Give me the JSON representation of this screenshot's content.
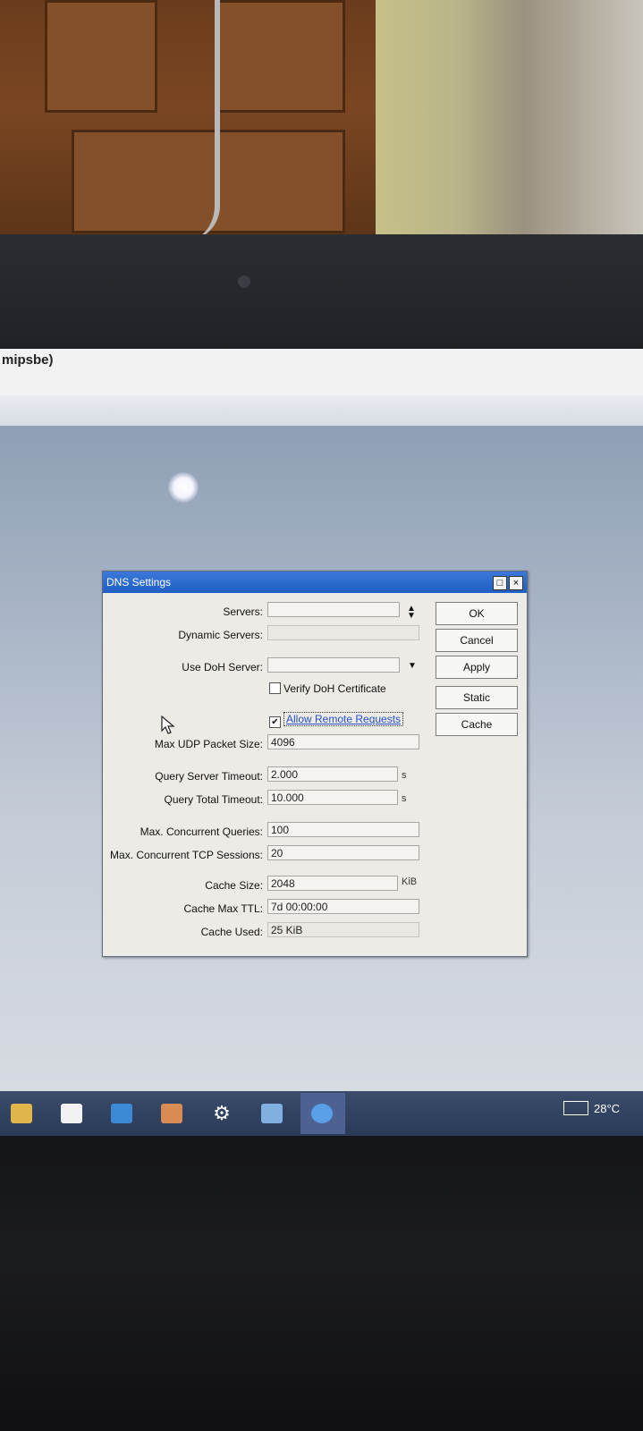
{
  "window": {
    "title_fragment": "mipsbe)"
  },
  "dialog": {
    "title": "DNS Settings",
    "title_buttons": [
      "□",
      "×"
    ],
    "fields": {
      "servers": {
        "label": "Servers:",
        "value": ""
      },
      "dynamic_servers": {
        "label": "Dynamic Servers:",
        "value": ""
      },
      "use_doh_server": {
        "label": "Use DoH Server:",
        "value": ""
      },
      "max_udp_packet_size": {
        "label": "Max UDP Packet Size:",
        "value": "4096"
      },
      "query_server_timeout": {
        "label": "Query Server Timeout:",
        "value": "2.000",
        "unit": "s"
      },
      "query_total_timeout": {
        "label": "Query Total Timeout:",
        "value": "10.000",
        "unit": "s"
      },
      "max_concurrent_queries": {
        "label": "Max. Concurrent Queries:",
        "value": "100"
      },
      "max_concurrent_tcp_sessions": {
        "label": "Max. Concurrent TCP Sessions:",
        "value": "20"
      },
      "cache_size": {
        "label": "Cache Size:",
        "value": "2048",
        "unit": "KiB"
      },
      "cache_max_ttl": {
        "label": "Cache Max TTL:",
        "value": "7d 00:00:00"
      },
      "cache_used": {
        "label": "Cache Used:",
        "value": "25 KiB"
      }
    },
    "checkboxes": {
      "verify_doh_certificate": {
        "label": "Verify DoH Certificate",
        "checked": false
      },
      "allow_remote_requests": {
        "label": "Allow Remote Requests",
        "checked": true
      }
    },
    "buttons": {
      "ok": "OK",
      "cancel": "Cancel",
      "apply": "Apply",
      "static": "Static",
      "cache": "Cache"
    }
  },
  "taskbar": {
    "icons": [
      "file-explorer-icon",
      "store-icon",
      "mail-icon",
      "media-icon",
      "settings-icon",
      "winbox-icon",
      "browser-icon"
    ],
    "temperature": "28°C"
  },
  "colors": {
    "titlebar": "#2a68cc",
    "dialog_bg": "#ecebe6",
    "taskbar": "#2f4060"
  }
}
